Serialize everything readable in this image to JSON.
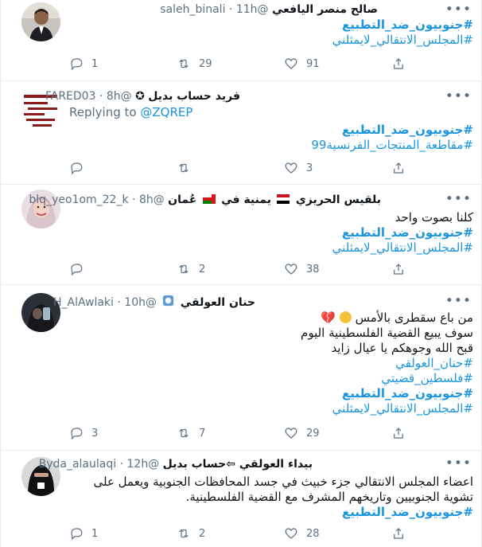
{
  "tweets": [
    {
      "name": "صالح منصر اليافعي",
      "handle": "@saleh_binali",
      "time": "11h",
      "lines": [
        {
          "text": "#جنوبيون_ضد_التطبيع",
          "kind": "tag-bold"
        },
        {
          "text": "#المجلس_الانتقالي_لايمثلني",
          "kind": "tag"
        }
      ],
      "replies": "1",
      "retweets": "29",
      "likes": "91"
    },
    {
      "name": "فريد حساب بديل",
      "handle": "@FARED03",
      "time": "8h",
      "replying_label": "Replying to",
      "replying_to": "@ZQREP",
      "lines": [
        {
          "text": "#جنوبيون_ضد_التطبيع",
          "kind": "tag-bold"
        },
        {
          "text": "#مقاطعة_المنتجات_الفرنسية99",
          "kind": "tag"
        }
      ],
      "replies": "",
      "retweets": "",
      "likes": "3"
    },
    {
      "name": "بلقيس الحريزي",
      "name_suffix": "يمنية في",
      "name_suffix2": "عُمان",
      "handle": "@blq_yeo1om_22_k",
      "time": "8h",
      "lines": [
        {
          "text": "كلنا بصوت واحد",
          "kind": "text"
        },
        {
          "text": "#جنوبيون_ضد_التطبيع",
          "kind": "tag-bold"
        },
        {
          "text": "#المجلس_الانتقالي_لايمثلني",
          "kind": "tag"
        }
      ],
      "replies": "",
      "retweets": "2",
      "likes": "38"
    },
    {
      "name": "حنان العولقي",
      "handle": "@H_AlAwlaki",
      "time": "10h",
      "lines": [
        {
          "text": "من باع سقطرى بالأمس",
          "kind": "text"
        },
        {
          "text": "سوف يبيع القضية الفلسطينية اليوم",
          "kind": "text"
        },
        {
          "text": "قبح الله وجوهكم يا عيال زايد",
          "kind": "text"
        },
        {
          "text": "#حنان_العولقي",
          "kind": "tag"
        },
        {
          "text": "#فلسطين_قضيتي",
          "kind": "tag"
        },
        {
          "text": "#جنوبيون_ضد_التطبيع",
          "kind": "tag-bold"
        },
        {
          "text": "#المجلس_الانتقالي_لايمثلني",
          "kind": "tag"
        }
      ],
      "replies": "3",
      "retweets": "7",
      "likes": "29"
    },
    {
      "name": "بيداء العولقي ⇦حساب بديل",
      "handle": "@Byda_alaulaqi",
      "time": "12h",
      "lines": [
        {
          "text": "اعضاء المجلس الانتقالي جزء خبيث في جسد المحافظات الجنوبية ويعمل على",
          "kind": "text"
        },
        {
          "text": "تشوية الجنوبيين وتاريخهم المشرف مع القضية الفلسطينية.",
          "kind": "text"
        },
        {
          "text": "#جنوبيون_ضد_التطبيع",
          "kind": "tag-bold"
        }
      ],
      "replies": "1",
      "retweets": "2",
      "likes": "28"
    }
  ],
  "icons": {
    "more": "more-horizontal-icon",
    "reply": "reply-icon",
    "retweet": "retweet-icon",
    "like": "heart-icon",
    "share": "share-icon"
  },
  "colors": {
    "link": "#1b95e0",
    "muted": "#5b7083",
    "divider": "#e6ecf0"
  }
}
